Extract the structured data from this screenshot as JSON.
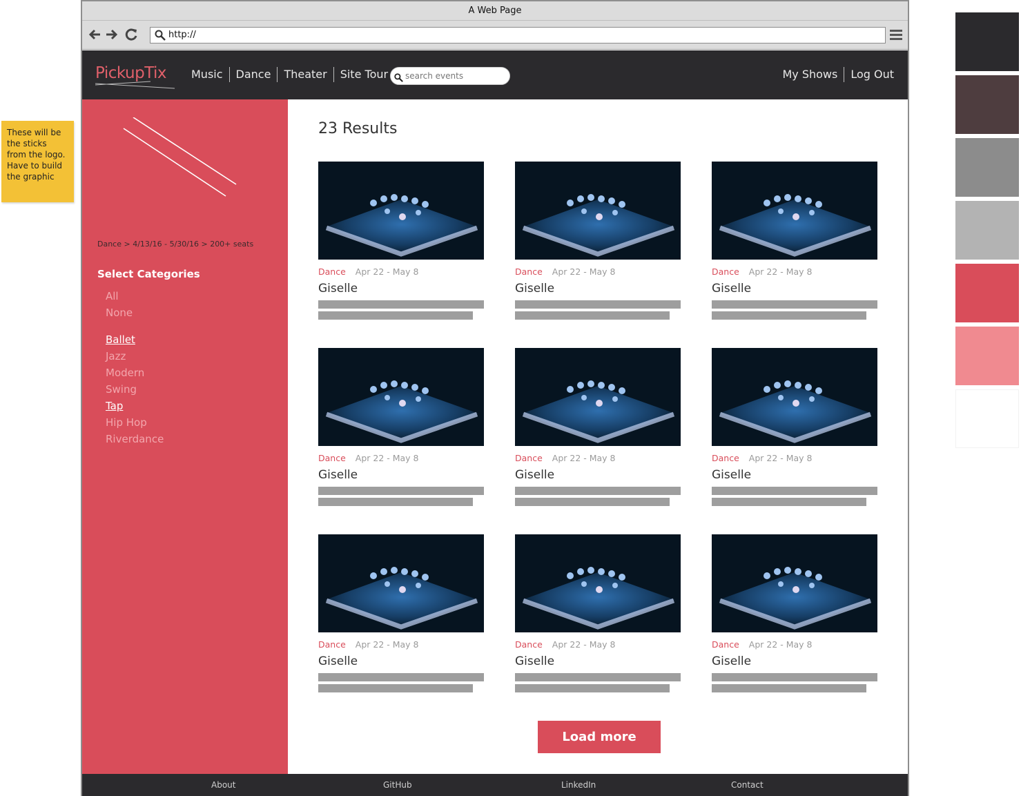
{
  "sticky_note": "These will be the sticks from the logo. Have to build the graphic",
  "palette": [
    "#2b2a2d",
    "#4e3d3f",
    "#8c8c8c",
    "#b3b3b3",
    "#d94d5a",
    "#f08a90",
    "#ffffff"
  ],
  "browser": {
    "title": "A Web Page",
    "url": "http://"
  },
  "header": {
    "logo": "PickupTix",
    "nav": [
      "Music",
      "Dance",
      "Theater",
      "Site Tour"
    ],
    "search_placeholder": "search events",
    "right_nav": [
      "My Shows",
      "Log Out"
    ]
  },
  "sidebar": {
    "breadcrumb": "Dance > 4/13/16 - 5/30/16 > 200+ seats",
    "categories_title": "Select Categories",
    "quick": [
      "All",
      "None"
    ],
    "categories": [
      {
        "label": "Ballet",
        "selected": true
      },
      {
        "label": "Jazz",
        "selected": false
      },
      {
        "label": "Modern",
        "selected": false
      },
      {
        "label": "Swing",
        "selected": false
      },
      {
        "label": "Tap",
        "selected": true
      },
      {
        "label": "Hip Hop",
        "selected": false
      },
      {
        "label": "Riverdance",
        "selected": false
      }
    ]
  },
  "main": {
    "results_label": "23 Results",
    "cards": [
      {
        "category": "Dance",
        "date": "Apr 22 - May 8",
        "title": "Giselle"
      },
      {
        "category": "Dance",
        "date": "Apr 22 - May 8",
        "title": "Giselle"
      },
      {
        "category": "Dance",
        "date": "Apr 22 - May 8",
        "title": "Giselle"
      },
      {
        "category": "Dance",
        "date": "Apr 22 - May 8",
        "title": "Giselle"
      },
      {
        "category": "Dance",
        "date": "Apr 22 - May 8",
        "title": "Giselle"
      },
      {
        "category": "Dance",
        "date": "Apr 22 - May 8",
        "title": "Giselle"
      },
      {
        "category": "Dance",
        "date": "Apr 22 - May 8",
        "title": "Giselle"
      },
      {
        "category": "Dance",
        "date": "Apr 22 - May 8",
        "title": "Giselle"
      },
      {
        "category": "Dance",
        "date": "Apr 22 - May 8",
        "title": "Giselle"
      }
    ],
    "load_more": "Load more"
  },
  "footer": [
    "About",
    "GitHub",
    "LinkedIn",
    "Contact"
  ]
}
